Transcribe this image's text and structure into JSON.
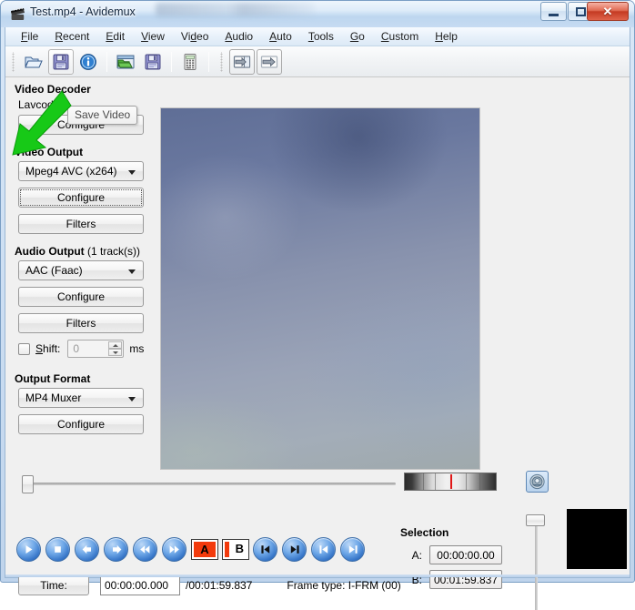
{
  "window": {
    "title": "Test.mp4 - Avidemux",
    "icon": "film-clapper-icon",
    "minimize_label": "Minimize",
    "maximize_label": "Maximize",
    "close_label": "✕"
  },
  "menubar": {
    "items": [
      {
        "label": "File",
        "mnemonic": "F"
      },
      {
        "label": "Recent",
        "mnemonic": "R"
      },
      {
        "label": "Edit",
        "mnemonic": "E"
      },
      {
        "label": "View",
        "mnemonic": "V"
      },
      {
        "label": "Video",
        "mnemonic": "d"
      },
      {
        "label": "Audio",
        "mnemonic": "A"
      },
      {
        "label": "Auto",
        "mnemonic": "A"
      },
      {
        "label": "Tools",
        "mnemonic": "T"
      },
      {
        "label": "Go",
        "mnemonic": "G"
      },
      {
        "label": "Custom",
        "mnemonic": "C"
      },
      {
        "label": "Help",
        "mnemonic": "H"
      }
    ]
  },
  "toolbar": {
    "buttons": [
      {
        "name": "open-video-icon",
        "tip": "Open Video"
      },
      {
        "name": "save-video-icon",
        "tip": "Save Video"
      },
      {
        "name": "info-icon",
        "tip": "Properties"
      },
      {
        "name": "open-project-icon",
        "tip": "Open Project"
      },
      {
        "name": "save-project-icon",
        "tip": "Save Project"
      },
      {
        "name": "calculator-icon",
        "tip": "Calculator"
      },
      {
        "name": "jump-to-start-icon",
        "tip": "Jump A"
      },
      {
        "name": "jump-to-end-icon",
        "tip": "Jump B"
      }
    ]
  },
  "tooltip": {
    "text": "Save Video"
  },
  "left_panel": {
    "video_decoder": {
      "title": "Video Decoder",
      "codec": "Lavcodec",
      "configure_label": "Configure"
    },
    "video_output": {
      "title": "Video Output",
      "selected": "Mpeg4 AVC (x264)",
      "configure_label": "Configure",
      "filters_label": "Filters"
    },
    "audio_output": {
      "title": "Audio Output",
      "subtitle": "(1 track(s))",
      "selected": "AAC (Faac)",
      "configure_label": "Configure",
      "filters_label": "Filters",
      "shift_label": "Shift:",
      "shift_value": "0",
      "shift_units": "ms",
      "shift_checked": false
    },
    "output_format": {
      "title": "Output Format",
      "selected": "MP4 Muxer",
      "configure_label": "Configure"
    }
  },
  "playback": {
    "buttons": [
      {
        "name": "play-button",
        "glyph": "play"
      },
      {
        "name": "stop-button",
        "glyph": "stop"
      },
      {
        "name": "previous-frame-button",
        "glyph": "arrow-left"
      },
      {
        "name": "next-frame-button",
        "glyph": "arrow-right"
      },
      {
        "name": "rewind-button",
        "glyph": "double-left"
      },
      {
        "name": "forward-button",
        "glyph": "double-right"
      },
      {
        "name": "marker-a-button",
        "glyph": "marker-a",
        "letter": "A"
      },
      {
        "name": "marker-b-button",
        "glyph": "marker-b",
        "letter": "B"
      },
      {
        "name": "go-to-marker-a-button",
        "glyph": "skip-start"
      },
      {
        "name": "go-to-marker-b-button",
        "glyph": "skip-end"
      },
      {
        "name": "previous-keyframe-button",
        "glyph": "prev-key"
      },
      {
        "name": "next-keyframe-button",
        "glyph": "next-key"
      }
    ]
  },
  "time_row": {
    "time_button_label": "Time:",
    "current_time": "00:00:00.000",
    "total_time": "/00:01:59.837",
    "frame_type": "Frame type: I-FRM (00)"
  },
  "selection": {
    "title": "Selection",
    "a_label": "A:",
    "a_value": "00:00:00.00",
    "b_label": "B:",
    "b_value": "00:01:59.837"
  },
  "audio": {
    "meter_name": "audio-level-meter",
    "speaker_name": "speaker-icon",
    "volume_slider_name": "volume-slider"
  },
  "colors": {
    "accent_blue": "#2f6fc4",
    "marker_red": "#f33a0c",
    "annotation_green": "#22c322",
    "title_blue": "#bdd6ef",
    "panel_gray": "#f0f0f0"
  },
  "annotation": {
    "arrow_name": "green-arrow-annotation",
    "points_to": "save-video-icon"
  }
}
